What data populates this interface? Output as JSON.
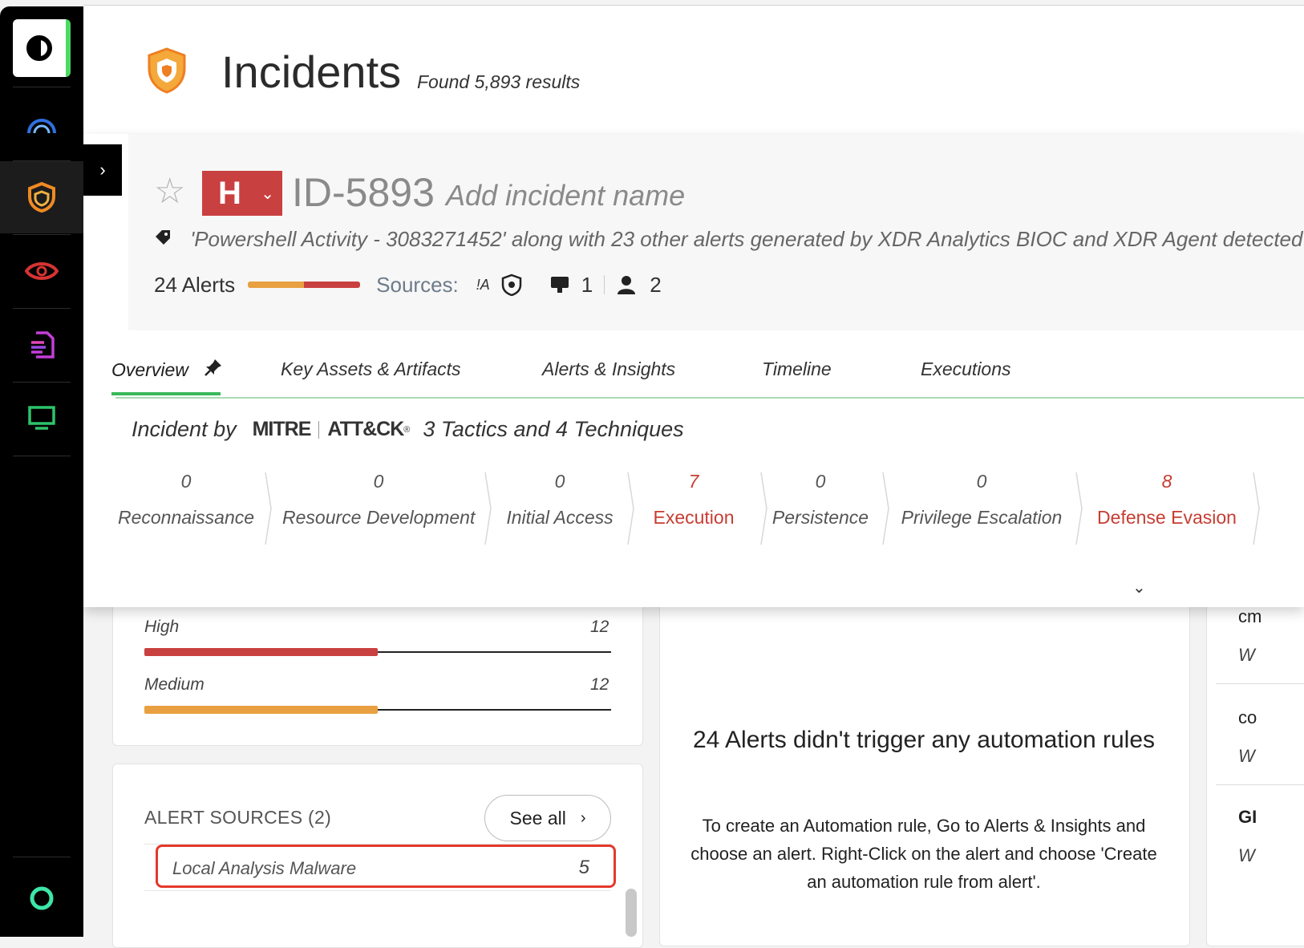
{
  "header": {
    "title": "Incidents",
    "found_text": "Found 5,893 results"
  },
  "incident": {
    "severity": "H",
    "id": "ID-5893",
    "name_placeholder": "Add incident name",
    "description": "'Powershell Activity - 3083271452' along with 23 other alerts generated by XDR Analytics BIOC and XDR Agent detected",
    "alerts_label": "24 Alerts",
    "sources_label": "Sources:",
    "sources_a": "!A",
    "hosts_count": "1",
    "users_count": "2"
  },
  "tabs": [
    {
      "label": "Overview"
    },
    {
      "label": "Key Assets & Artifacts"
    },
    {
      "label": "Alerts & Insights"
    },
    {
      "label": "Timeline"
    },
    {
      "label": "Executions"
    }
  ],
  "mitre": {
    "prefix": "Incident by",
    "logo_left": "MITRE",
    "logo_right": "ATT&CK",
    "logo_mark": "®",
    "summary": "3 Tactics and 4 Techniques"
  },
  "tactics": [
    {
      "count": "0",
      "name": "Reconnaissance"
    },
    {
      "count": "0",
      "name": "Resource Development"
    },
    {
      "count": "0",
      "name": "Initial Access"
    },
    {
      "count": "7",
      "name": "Execution"
    },
    {
      "count": "0",
      "name": "Persistence"
    },
    {
      "count": "0",
      "name": "Privilege Escalation"
    },
    {
      "count": "8",
      "name": "Defense Evasion"
    }
  ],
  "severity_breakdown": [
    {
      "label": "High",
      "count": "12",
      "fraction": 0.5,
      "color": "#c94040"
    },
    {
      "label": "Medium",
      "count": "12",
      "fraction": 0.5,
      "color": "#e8a040"
    }
  ],
  "alert_sources": {
    "title": "ALERT SOURCES (2)",
    "see_all": "See all",
    "items": [
      {
        "name": "Local Analysis Malware",
        "count": "5"
      }
    ]
  },
  "automation": {
    "heading": "24 Alerts didn't trigger any automation rules",
    "body": "To create an Automation rule, Go to Alerts & Insights and choose an alert. Right-Click on the alert and choose 'Create an automation rule from alert'."
  },
  "right_column": [
    {
      "label": "cm",
      "sub": "W"
    },
    {
      "label": "co",
      "sub": "W"
    },
    {
      "label": "GI",
      "sub": "W"
    }
  ],
  "colors": {
    "accent_green": "#38b95a",
    "severity_high": "#c94040",
    "severity_medium": "#e8a040",
    "tactic_hot": "#c73d33",
    "highlight_red": "#e5392c"
  }
}
